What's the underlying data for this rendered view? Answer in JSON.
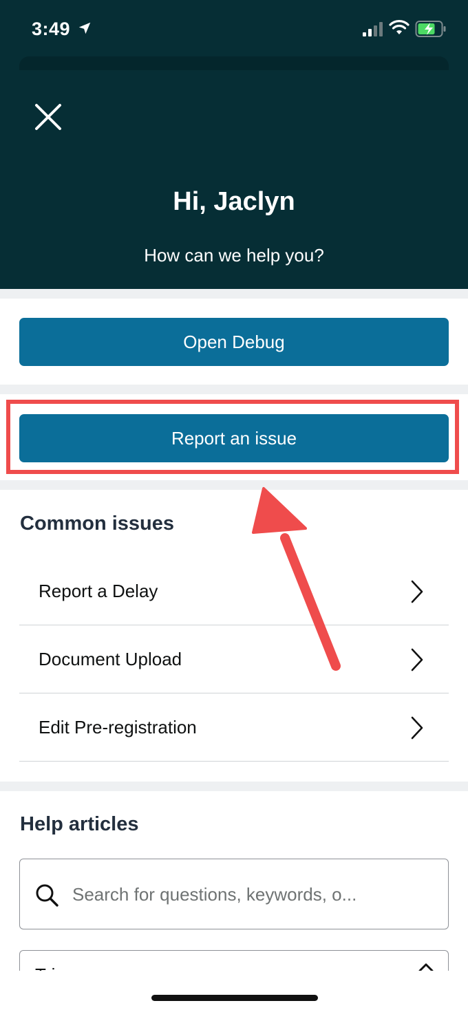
{
  "status_bar": {
    "time": "3:49"
  },
  "header": {
    "greeting": "Hi, Jaclyn",
    "subtitle": "How can we help you?"
  },
  "actions": {
    "open_debug": "Open Debug",
    "report_issue": "Report an issue"
  },
  "common_issues": {
    "title": "Common issues",
    "items": [
      {
        "label": "Report a Delay"
      },
      {
        "label": "Document Upload"
      },
      {
        "label": "Edit Pre-registration"
      }
    ]
  },
  "help_articles": {
    "title": "Help articles",
    "search": {
      "placeholder": "Search for questions, keywords, o...",
      "value": ""
    },
    "trips_label": "Trips"
  },
  "colors": {
    "header_bg": "#062e35",
    "button_bg": "#0b6e99",
    "highlight": "#ef4c4c",
    "section_gap": "#eef0f2"
  }
}
